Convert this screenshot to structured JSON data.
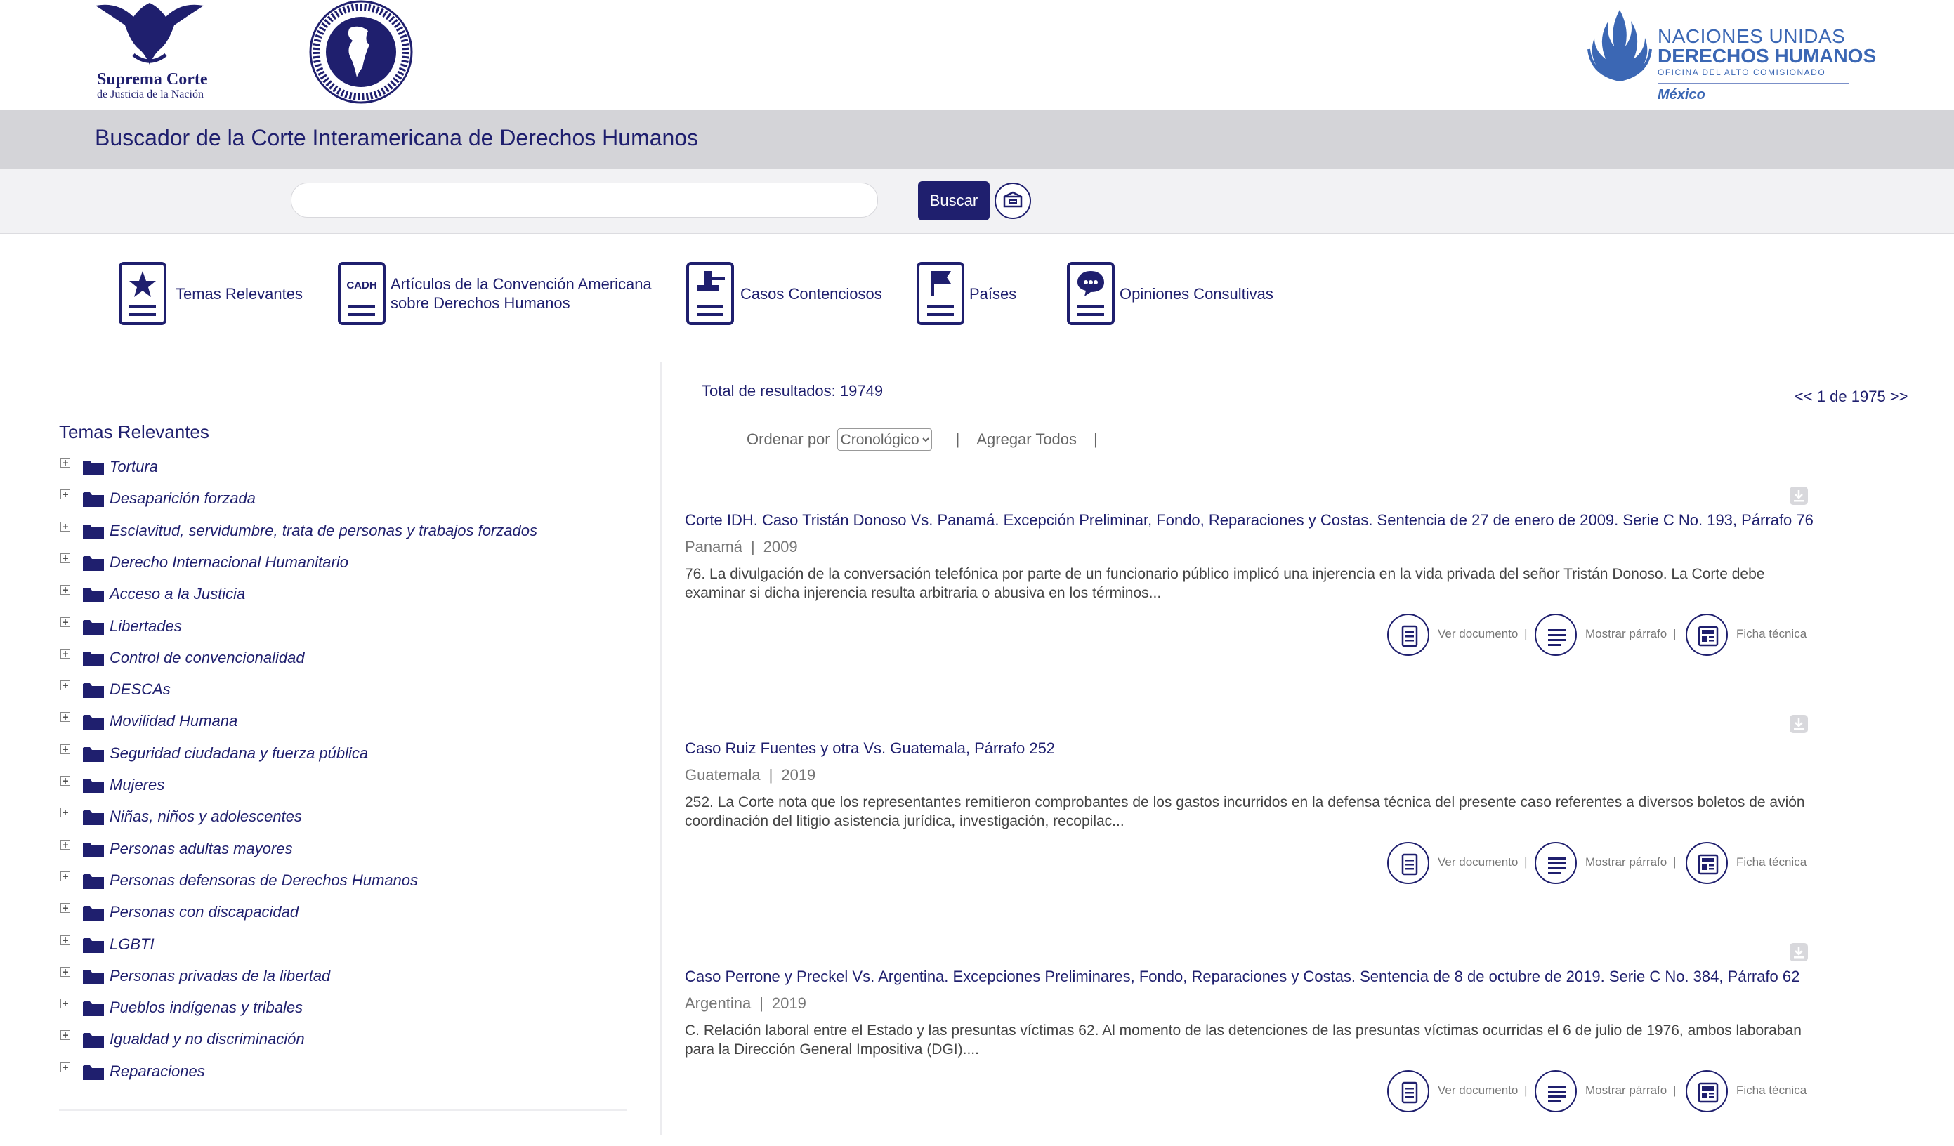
{
  "header": {
    "scjn_line1": "Suprema Corte",
    "scjn_line2": "de Justicia de la Nación",
    "onu_line1": "NACIONES UNIDAS",
    "onu_line2": "DERECHOS HUMANOS",
    "onu_line3": "OFICINA DEL ALTO COMISIONADO",
    "onu_line4": "México"
  },
  "title": "Buscador de la Corte Interamericana de Derechos Humanos",
  "search": {
    "placeholder": "",
    "button": "Buscar"
  },
  "categories": [
    {
      "label": "Temas Relevantes",
      "icon": "star-document-icon"
    },
    {
      "label1": "Artículos de la Convención Americana",
      "label2": "sobre Derechos Humanos",
      "icon": "cadh-document-icon",
      "badge": "CADH"
    },
    {
      "label": "Casos Contenciosos",
      "icon": "gavel-document-icon"
    },
    {
      "label": "Países",
      "icon": "flag-document-icon"
    },
    {
      "label": "Opiniones Consultivas",
      "icon": "speech-bubble-document-icon"
    }
  ],
  "sidebar": {
    "title": "Temas Relevantes",
    "items": [
      "Tortura",
      "Desaparición forzada",
      "Esclavitud, servidumbre, trata de personas y trabajos forzados",
      "Derecho Internacional Humanitario",
      "Acceso a la Justicia",
      "Libertades",
      "Control de convencionalidad",
      "DESCAs",
      "Movilidad Humana",
      "Seguridad ciudadana y fuerza pública",
      "Mujeres",
      "Niñas, niños y adolescentes",
      "Personas adultas mayores",
      "Personas defensoras de Derechos Humanos",
      "Personas con discapacidad",
      "LGBTI",
      "Personas privadas de la libertad",
      "Pueblos indígenas y tribales",
      "Igualdad y no discriminación",
      "Reparaciones"
    ]
  },
  "results": {
    "total": "Total de resultados: 19749",
    "pager": "<< 1 de 1975 >>",
    "sort_label": "Ordenar por",
    "sort_selected": "Cronológico",
    "add_all": "Agregar Todos",
    "separator": "|",
    "actions": {
      "view": "Ver documento",
      "show": "Mostrar párrafo",
      "sheet": "Ficha técnica",
      "sep": "|"
    },
    "items": [
      {
        "title": "Corte IDH. Caso Tristán Donoso Vs. Panamá. Excepción Preliminar, Fondo, Reparaciones y Costas. Sentencia de 27 de enero de 2009. Serie C No. 193, Párrafo 76",
        "country": "Panamá",
        "year": "2009",
        "excerpt": "76. La divulgación de la conversación telefónica por parte de un funcionario público implicó una injerencia en la vida privada del señor Tristán Donoso. La Corte debe examinar si dicha injerencia resulta arbitraria o abusiva en los términos..."
      },
      {
        "title": "Caso Ruiz Fuentes y otra Vs. Guatemala, Párrafo 252",
        "country": "Guatemala",
        "year": "2019",
        "excerpt": "252. La Corte nota que los representantes remitieron comprobantes de los gastos incurridos en la defensa técnica del presente caso referentes a diversos boletos de avión coordinación del litigio asistencia jurídica, investigación, recopilac..."
      },
      {
        "title": "Caso Perrone y Preckel Vs. Argentina. Excepciones Preliminares, Fondo, Reparaciones y Costas. Sentencia de 8 de octubre de 2019. Serie C No. 384, Párrafo 62",
        "country": "Argentina",
        "year": "2019",
        "excerpt": "C. Relación laboral entre el Estado y las presuntas víctimas 62. Al momento de las detenciones de las presuntas víctimas ocurridas el 6 de julio de 1976, ambos laboraban para la Dirección General Impositiva (DGI)...."
      }
    ]
  },
  "colors": {
    "navy": "#1f1f6e",
    "title_bar": "#d4d4d8",
    "search_bar": "#f2f2f4",
    "onu_blue": "#3b67b4"
  }
}
